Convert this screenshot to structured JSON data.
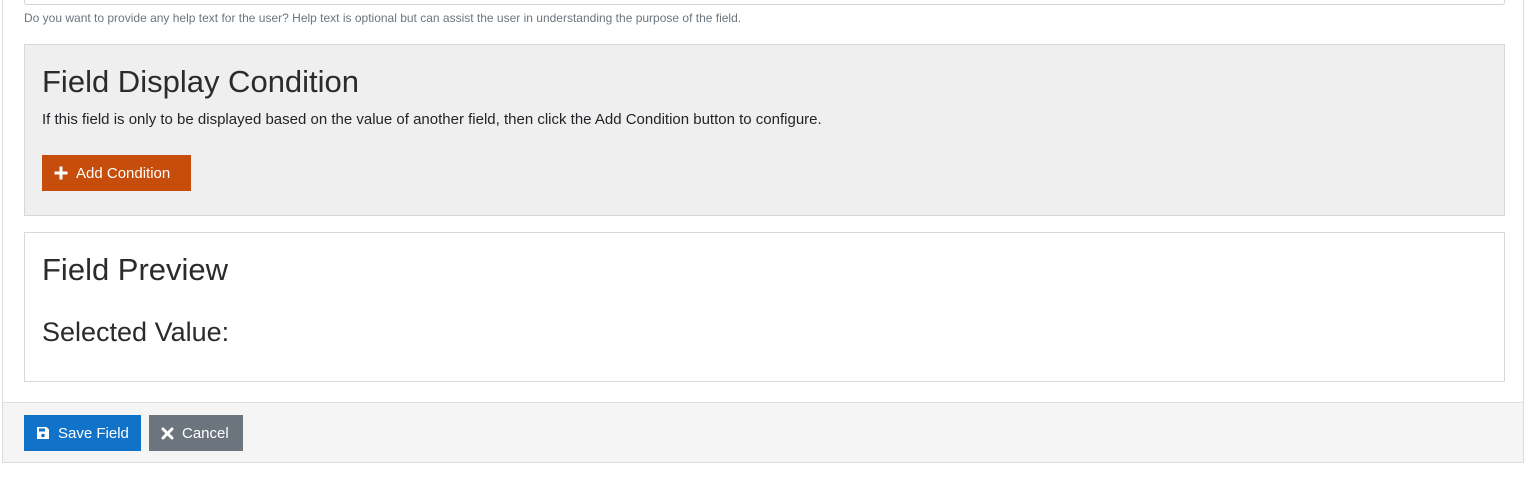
{
  "help_text": {
    "hint": "Do you want to provide any help text for the user? Help text is optional but can assist the user in understanding the purpose of the field."
  },
  "display_condition": {
    "title": "Field Display Condition",
    "description": "If this field is only to be displayed based on the value of another field, then click the Add Condition button to configure.",
    "add_button_label": "Add Condition",
    "add_button_icon": "plus-icon",
    "accent_color": "#c74d0c"
  },
  "preview": {
    "title": "Field Preview",
    "selected_value_label": "Selected Value:"
  },
  "footer": {
    "save_label": "Save Field",
    "save_icon": "floppy-disk-icon",
    "save_color": "#1172c9",
    "cancel_label": "Cancel",
    "cancel_icon": "close-icon",
    "cancel_color": "#6c757d"
  }
}
